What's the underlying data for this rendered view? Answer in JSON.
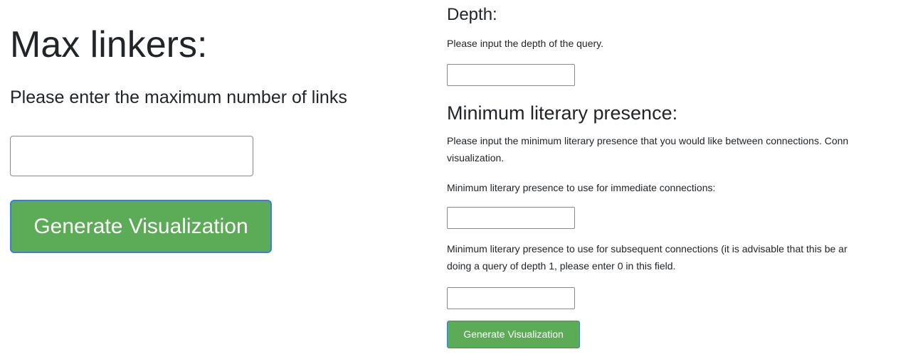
{
  "left_panel": {
    "title": "Max linkers:",
    "description": "Please enter the maximum number of links",
    "input_value": "",
    "button_label": "Generate Visualization"
  },
  "right_panel": {
    "depth": {
      "title": "Depth:",
      "description": "Please input the depth of the query.",
      "input_value": ""
    },
    "min_presence": {
      "title": "Minimum literary presence:",
      "description_line1": "Please input the minimum literary presence that you would like between connections. Conn",
      "description_line2": "visualization.",
      "immediate_label": "Minimum literary presence to use for immediate connections:",
      "immediate_value": "",
      "subsequent_label_line1": "Minimum literary presence to use for subsequent connections (it is advisable that this be ar",
      "subsequent_label_line2": "doing a query of depth 1, please enter 0 in this field.",
      "subsequent_value": ""
    },
    "button_label": "Generate Visualization"
  },
  "colors": {
    "button_bg": "#5cab57",
    "button_border": "#3d7fd6",
    "text": "#212529"
  }
}
